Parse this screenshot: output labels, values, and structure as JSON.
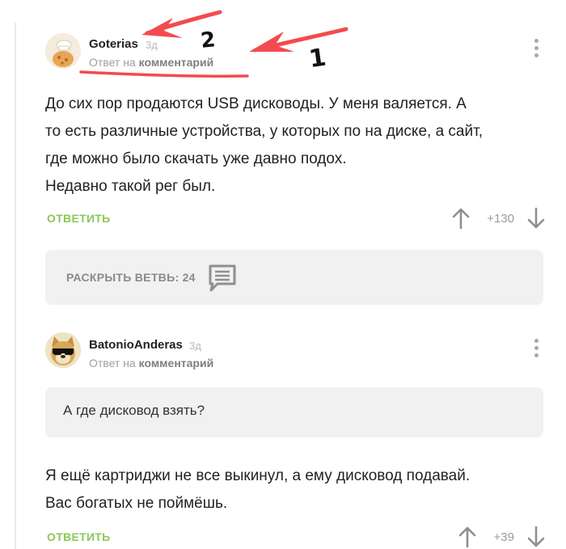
{
  "colors": {
    "accent_green": "#8ac858",
    "muted_text": "#9e9e9e",
    "annotation_red": "#f24b4f",
    "box_bg": "#f1f1f1"
  },
  "comment1": {
    "username": "Goterias",
    "time": "3д",
    "reply_prefix": "Ответ на",
    "reply_target": "комментарий",
    "body_lines": [
      "До сих пор продаются USB дисководы. У меня валяется. А",
      "то есть различные устройства, у которых по на диске, а сайт,",
      "где можно было скачать уже давно подох.",
      "Недавно такой рег был."
    ],
    "reply_label": "ОТВЕТИТЬ",
    "score": "+130",
    "icons": {
      "menu": "kebab-icon",
      "up": "arrow-up-icon",
      "down": "arrow-down-icon"
    }
  },
  "expand_thread": {
    "label": "РАСКРЫТЬ ВЕТВЬ: 24",
    "icon": "comment-icon"
  },
  "comment2": {
    "username": "BatonioAnderas",
    "time": "3д",
    "reply_prefix": "Ответ на",
    "reply_target": "комментарий",
    "quote": "А где дисковод взять?",
    "body_lines": [
      "Я ещё картриджи не все выкинул, а ему дисковод подавай.",
      "Вас богатых не поймёшь."
    ],
    "reply_label": "ОТВЕТИТЬ",
    "score": "+39"
  },
  "annotations": {
    "label_1": "1",
    "label_2": "2"
  }
}
